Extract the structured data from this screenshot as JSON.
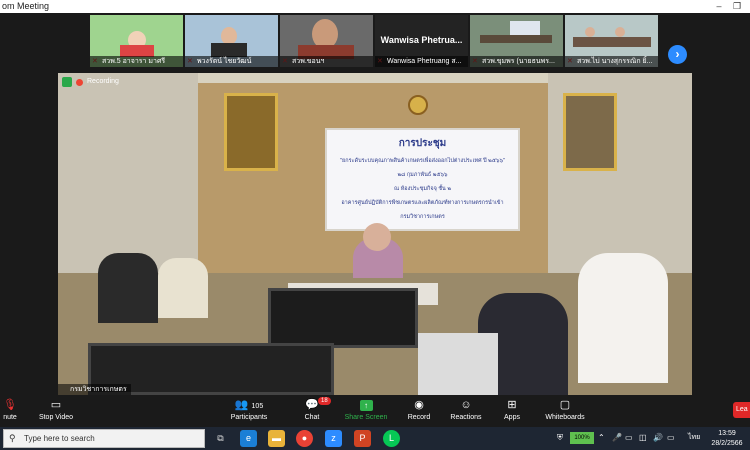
{
  "window": {
    "title": "om Meeting",
    "controls": [
      "–",
      "❐"
    ]
  },
  "gallery": {
    "participants": [
      {
        "name": "สวพ.5 อาจารา มาศรี",
        "kind": "video",
        "bg": "#9fd48f"
      },
      {
        "name": "พวงรัตน์  ไชยวัฒน์",
        "kind": "video",
        "bg": "#a9c3d8"
      },
      {
        "name": "สวพ.ขอนฯ",
        "kind": "video",
        "bg": "#6a6a6a"
      },
      {
        "name": "Wanwisa Phetruang ส...",
        "kind": "name-only",
        "display": "Wanwisa  Phetrua..."
      },
      {
        "name": "สวพ.ขุมพร (นายธนพร...",
        "kind": "video",
        "bg": "#7b8f7a"
      },
      {
        "name": "สวพ.ไบ่ นางสุกรรณิก  ยิ้...",
        "kind": "video",
        "bg": "#b8c8c7"
      }
    ],
    "next_icon": "chevron-right-icon"
  },
  "main_video": {
    "recording_label": "Recording",
    "speaker_name": "กรมวิชาการเกษตร",
    "screen": {
      "title": "การประชุม",
      "lines": [
        "\"ยกระดับระบบคุณภาพสินค้าเกษตรเพื่อส่งออกไปต่างประเทศ ปี ๒๕๖๖\"",
        "๒๘ กุมภาพันธ์ ๒๕๖๖",
        "ณ ห้องประชุมกิจจุ ชั้น ๒",
        "อาคารศูนย์ปฏิบัติการพืชเกษตรและผลิตภัณฑ์ทางการเกษตรกรนำเข้า",
        "กรมวิชาการเกษตร"
      ]
    }
  },
  "toolbar": {
    "items": [
      {
        "label": "nute",
        "icon": "mic-muted-icon"
      },
      {
        "label": "Stop Video",
        "icon": "video-camera-icon"
      },
      {
        "label": "Participants",
        "icon": "participants-icon",
        "count": "105"
      },
      {
        "label": "Chat",
        "icon": "chat-icon",
        "badge": "18"
      },
      {
        "label": "Share Screen",
        "icon": "share-screen-icon"
      },
      {
        "label": "Record",
        "icon": "record-icon"
      },
      {
        "label": "Reactions",
        "icon": "reactions-icon"
      },
      {
        "label": "Apps",
        "icon": "apps-icon"
      },
      {
        "label": "Whiteboards",
        "icon": "whiteboard-icon"
      }
    ],
    "leave_label": "Lea"
  },
  "taskbar": {
    "search_placeholder": "Type here to search",
    "battery": "100%",
    "lang": "ไทย",
    "time": "13:59",
    "date": "28/2/2566"
  },
  "colors": {
    "zoom_blue": "#2d8cff",
    "share_green": "#2fb24c",
    "danger": "#e02828"
  }
}
